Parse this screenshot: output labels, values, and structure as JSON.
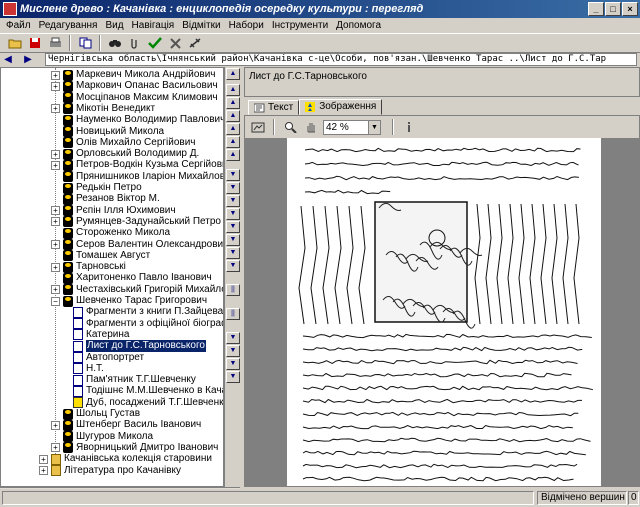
{
  "window": {
    "title": "Мислене древо : Качанівка : енциклопедія осередку культури : перегляд",
    "controls": [
      "_",
      "□",
      "×"
    ]
  },
  "menu": [
    "Файл",
    "Редагування",
    "Вид",
    "Навігація",
    "Відмітки",
    "Набори",
    "Інструменти",
    "Допомога"
  ],
  "toolbar": {
    "icons": [
      "open-folder-icon",
      "save-icon",
      "print-icon",
      "copy-icon",
      "binoculars-icon",
      "attach-icon",
      "check-icon",
      "cancel-icon",
      "link-icon"
    ]
  },
  "address": {
    "path": "Чернігівська область\\Ічнянський район\\Качанівка с-це\\Особи, пов'язан.\\Шевченко Тарас ..\\Лист до Г.С.Тар"
  },
  "tree": {
    "items": [
      {
        "label": "Маркевич Микола Андрійович",
        "icon": "person",
        "indent": 0,
        "expander": "+"
      },
      {
        "label": "Маркович Опанас Васильович",
        "icon": "person",
        "indent": 0,
        "expander": "+"
      },
      {
        "label": "Мосціпанов Максим Климович",
        "icon": "person",
        "indent": 0,
        "expander": ""
      },
      {
        "label": "Мікотін Венедикт",
        "icon": "person",
        "indent": 0,
        "expander": "+"
      },
      {
        "label": "Науменко Володимир Павлович",
        "icon": "person",
        "indent": 0,
        "expander": ""
      },
      {
        "label": "Новицький Микола",
        "icon": "person",
        "indent": 0,
        "expander": ""
      },
      {
        "label": "Олів Михайло Сергійович",
        "icon": "person",
        "indent": 0,
        "expander": ""
      },
      {
        "label": "Орловський Володимир Д.",
        "icon": "person",
        "indent": 0,
        "expander": "+"
      },
      {
        "label": "Петров-Водкін Кузьма Сергійович",
        "icon": "person",
        "indent": 0,
        "expander": "+"
      },
      {
        "label": "Прянишников Іларіон Михайлович",
        "icon": "person",
        "indent": 0,
        "expander": ""
      },
      {
        "label": "Редькін Петро",
        "icon": "person",
        "indent": 0,
        "expander": ""
      },
      {
        "label": "Резанов Віктор М.",
        "icon": "person",
        "indent": 0,
        "expander": ""
      },
      {
        "label": "Рєпін Ілля Юхимович",
        "icon": "person",
        "indent": 0,
        "expander": "+"
      },
      {
        "label": "Румянцев-Задунайський Петро О.",
        "icon": "person",
        "indent": 0,
        "expander": "+"
      },
      {
        "label": "Стороженко Микола",
        "icon": "person",
        "indent": 0,
        "expander": ""
      },
      {
        "label": "Серов Валентин Олександрович",
        "icon": "person",
        "indent": 0,
        "expander": "+"
      },
      {
        "label": "Томашек Август",
        "icon": "person",
        "indent": 0,
        "expander": ""
      },
      {
        "label": "Тарновські",
        "icon": "person",
        "indent": 0,
        "expander": "+"
      },
      {
        "label": "Харитоненко Павло Іванович",
        "icon": "person",
        "indent": 0,
        "expander": ""
      },
      {
        "label": "Честахівський Григорій Михайлович",
        "icon": "person",
        "indent": 0,
        "expander": "+"
      },
      {
        "label": "Шевченко Тарас Григорович",
        "icon": "person",
        "indent": 0,
        "expander": "−"
      },
      {
        "label": "Фрагменти з книги П.Зайцева",
        "icon": "doc",
        "indent": 1,
        "expander": ""
      },
      {
        "label": "Фрагменти з офіційної біографії",
        "icon": "doc",
        "indent": 1,
        "expander": ""
      },
      {
        "label": "Катерина",
        "icon": "doc",
        "indent": 1,
        "expander": ""
      },
      {
        "label": "Лист до Г.С.Тарновського",
        "icon": "doc",
        "indent": 1,
        "expander": "",
        "selected": true
      },
      {
        "label": "Автопортрет",
        "icon": "doc",
        "indent": 1,
        "expander": ""
      },
      {
        "label": "Н.Т.",
        "icon": "doc",
        "indent": 1,
        "expander": ""
      },
      {
        "label": "Пам'ятник Т.Г.Шевченку",
        "icon": "doc",
        "indent": 1,
        "expander": ""
      },
      {
        "label": "Тодішнє М.М.Шевченко в Качанівці",
        "icon": "doc",
        "indent": 1,
        "expander": ""
      },
      {
        "label": "Дуб, посаджений Т.Г.Шевченком",
        "icon": "yellow",
        "indent": 1,
        "expander": ""
      },
      {
        "label": "Шольц Густав",
        "icon": "person",
        "indent": 0,
        "expander": ""
      },
      {
        "label": "Штенберг Василь Іванович",
        "icon": "person",
        "indent": 0,
        "expander": "+"
      },
      {
        "label": "Шугуров Микола",
        "icon": "person",
        "indent": 0,
        "expander": ""
      },
      {
        "label": "Яворницький Дмитро Іванович",
        "icon": "person",
        "indent": 0,
        "expander": "+"
      },
      {
        "label": "Качанівська колекція старовини",
        "icon": "folder",
        "indent": -1,
        "expander": "+"
      },
      {
        "label": "Література про Качанівку",
        "icon": "folder",
        "indent": -1,
        "expander": "+"
      }
    ]
  },
  "node": {
    "title": "Лист до Г.С.Тарновського"
  },
  "tabs": [
    {
      "label": "Текст",
      "active": false
    },
    {
      "label": "Зображення",
      "active": true
    }
  ],
  "image_toolbar": {
    "zoom": "42 %"
  },
  "status": {
    "right": "Відмічено вершин",
    "count": "0"
  }
}
